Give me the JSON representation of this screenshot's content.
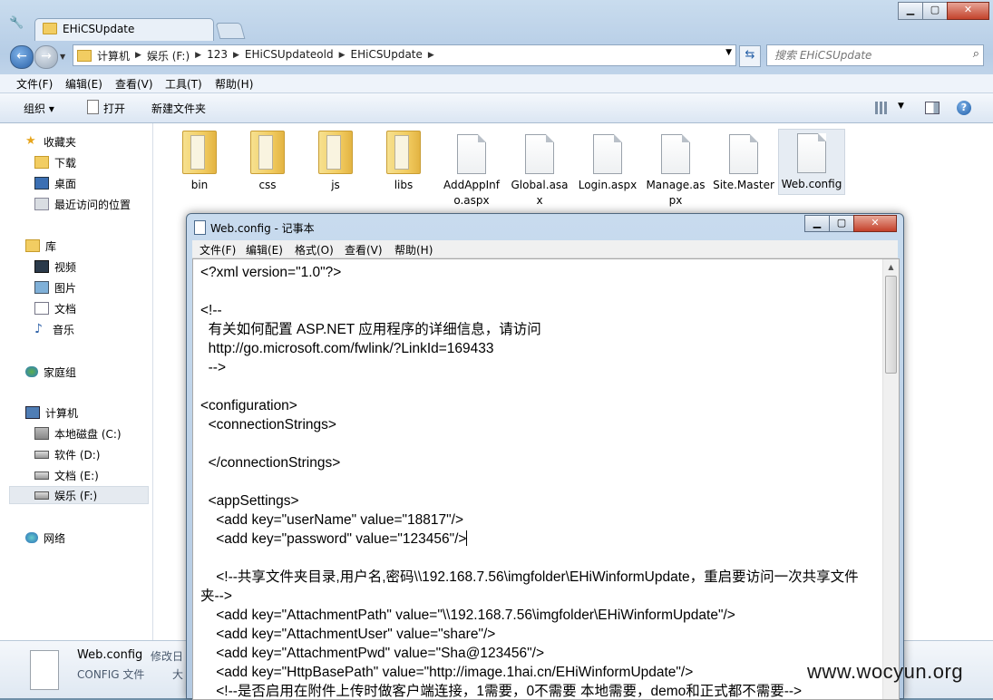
{
  "explorer": {
    "tab_title": "EHiCSUpdate",
    "address": [
      "计算机",
      "娱乐 (F:)",
      "123",
      "EHiCSUpdateold",
      "EHiCSUpdate"
    ],
    "search_placeholder": "搜索 EHiCSUpdate",
    "menu": [
      "文件(F)",
      "编辑(E)",
      "查看(V)",
      "工具(T)",
      "帮助(H)"
    ],
    "commands": {
      "organize": "组织 ▾",
      "open": "打开",
      "new_folder": "新建文件夹"
    },
    "nav": {
      "favorites": "收藏夹",
      "downloads": "下载",
      "desktop": "桌面",
      "recent": "最近访问的位置",
      "libraries": "库",
      "videos": "视频",
      "pictures": "图片",
      "documents": "文档",
      "music": "音乐",
      "homegroup": "家庭组",
      "computer": "计算机",
      "drive_c": "本地磁盘 (C:)",
      "drive_d": "软件 (D:)",
      "drive_e": "文档 (E:)",
      "drive_f": "娱乐 (F:)",
      "network": "网络"
    },
    "files": [
      {
        "name": "bin",
        "kind": "folder"
      },
      {
        "name": "css",
        "kind": "folder"
      },
      {
        "name": "js",
        "kind": "folder"
      },
      {
        "name": "libs",
        "kind": "folder"
      },
      {
        "name": "AddAppInfo.aspx",
        "kind": "file"
      },
      {
        "name": "Global.asax",
        "kind": "file"
      },
      {
        "name": "Login.aspx",
        "kind": "file"
      },
      {
        "name": "Manage.aspx",
        "kind": "file"
      },
      {
        "name": "Site.Master",
        "kind": "file"
      },
      {
        "name": "Web.config",
        "kind": "file"
      }
    ],
    "details": {
      "name": "Web.config",
      "type": "CONFIG 文件",
      "modified_label": "修改日",
      "size_label": "大"
    }
  },
  "notepad": {
    "title": "Web.config - 记事本",
    "menu": [
      "文件(F)",
      "编辑(E)",
      "格式(O)",
      "查看(V)",
      "帮助(H)"
    ],
    "text_before_caret": "<?xml version=\"1.0\"?>\n\n<!--\n  有关如何配置 ASP.NET 应用程序的详细信息，请访问\n  http://go.microsoft.com/fwlink/?LinkId=169433\n  -->\n\n<configuration>\n  <connectionStrings>\n\n  </connectionStrings>\n\n  <appSettings>\n    <add key=\"userName\" value=\"18817\"/>\n    <add key=\"password\" value=\"123456\"/>",
    "text_after_caret": "\n\n    <!--共享文件夹目录,用户名,密码\\\\192.168.7.56\\imgfolder\\EHiWinformUpdate，重启要访问一次共享文件夹-->\n    <add key=\"AttachmentPath\" value=\"\\\\192.168.7.56\\imgfolder\\EHiWinformUpdate\"/>\n    <add key=\"AttachmentUser\" value=\"share\"/>\n    <add key=\"AttachmentPwd\" value=\"Sha@123456\"/>\n    <add key=\"HttpBasePath\" value=\"http://image.1hai.cn/EHiWinformUpdate\"/>\n    <!--是否启用在附件上传时做客户端连接，1需要，0不需要 本地需要，demo和正式都不需要-->"
  },
  "watermark": "www.wocyun.org"
}
